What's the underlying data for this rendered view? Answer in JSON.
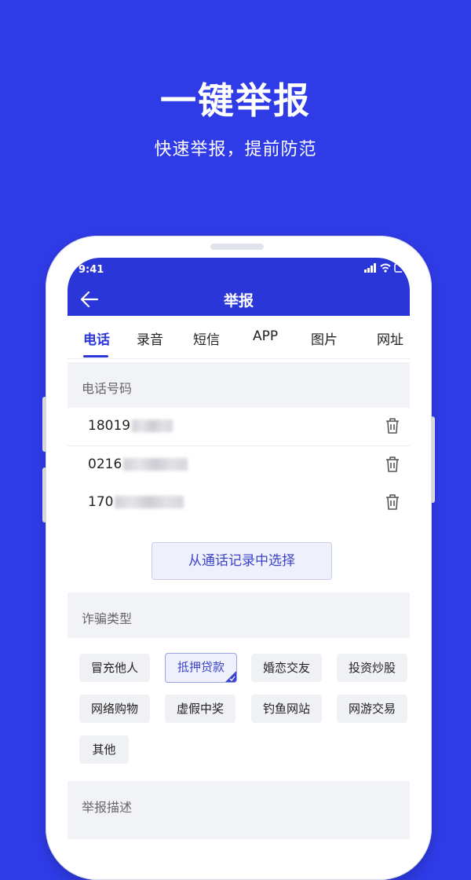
{
  "hero": {
    "title": "一键举报",
    "subtitle": "快速举报，提前防范"
  },
  "status": {
    "time": "9:41"
  },
  "nav": {
    "title": "举报"
  },
  "tabs": [
    {
      "label": "电话",
      "active": true
    },
    {
      "label": "录音",
      "active": false
    },
    {
      "label": "短信",
      "active": false
    },
    {
      "label": "APP",
      "active": false
    },
    {
      "label": "图片",
      "active": false
    },
    {
      "label": "网址",
      "active": false
    }
  ],
  "phone_section": {
    "label": "电话号码",
    "numbers": [
      {
        "visible_prefix": "18019"
      },
      {
        "visible_prefix": "0216"
      },
      {
        "visible_prefix": "170"
      }
    ],
    "select_button": "从通话记录中选择"
  },
  "fraud_section": {
    "label": "诈骗类型",
    "tags": [
      "冒充他人",
      "抵押贷款",
      "婚恋交友",
      "投资炒股",
      "网络购物",
      "虚假中奖",
      "钓鱼网站",
      "网游交易",
      "其他"
    ],
    "selected": "抵押贷款"
  },
  "description_section": {
    "label": "举报描述"
  },
  "colors": {
    "accent": "#2b36d9",
    "background": "#2f3be6"
  }
}
